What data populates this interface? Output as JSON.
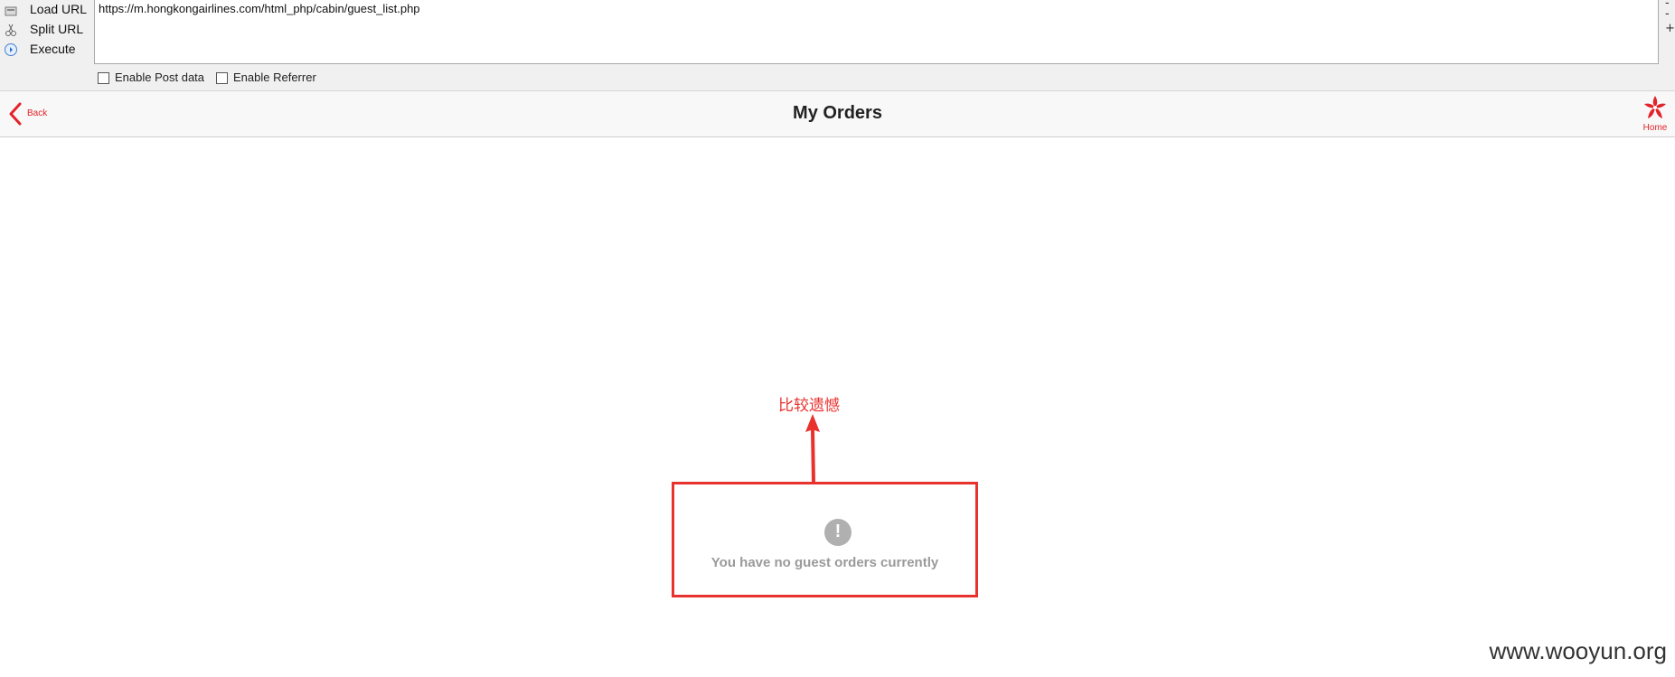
{
  "hackbar": {
    "commands": [
      {
        "label": "Load URL",
        "icon": "load-url-icon"
      },
      {
        "label": "Split URL",
        "icon": "split-url-icon"
      },
      {
        "label": "Execute",
        "icon": "execute-icon"
      }
    ],
    "url": "https://m.hongkongairlines.com/html_php/cabin/guest_list.php",
    "right_buttons": [
      "-",
      "-",
      "+"
    ],
    "options": [
      {
        "label": "Enable Post data",
        "checked": false
      },
      {
        "label": "Enable Referrer",
        "checked": false
      }
    ]
  },
  "header": {
    "back_label": "Back",
    "title": "My Orders",
    "home_label": "Home"
  },
  "main": {
    "empty_message": "You have no guest orders currently",
    "empty_icon": "exclamation-icon"
  },
  "annotation": {
    "text": "比较遗憾",
    "color": "#e8322e"
  },
  "watermark": "www.wooyun.org",
  "colors": {
    "brand_red": "#e1242a",
    "annotation_red": "#e8322e",
    "muted_gray": "#9a9a9a"
  }
}
